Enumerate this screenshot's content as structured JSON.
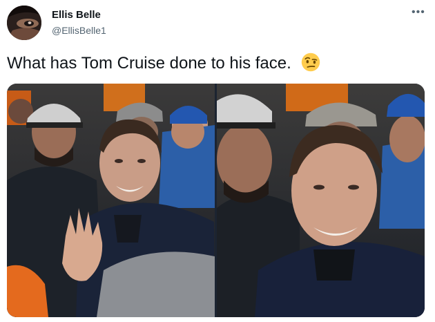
{
  "author": {
    "name": "Ellis Belle",
    "handle": "@EllisBelle1"
  },
  "tweet": {
    "text": "What has Tom Cruise done to his face.",
    "emoji": "face-with-raised-eyebrow-icon"
  },
  "menu": {
    "icon": "more-options-icon",
    "glyph": "•••"
  },
  "media": {
    "count": 2
  },
  "colors": {
    "text_primary": "#0f1419",
    "text_secondary": "#536471"
  }
}
